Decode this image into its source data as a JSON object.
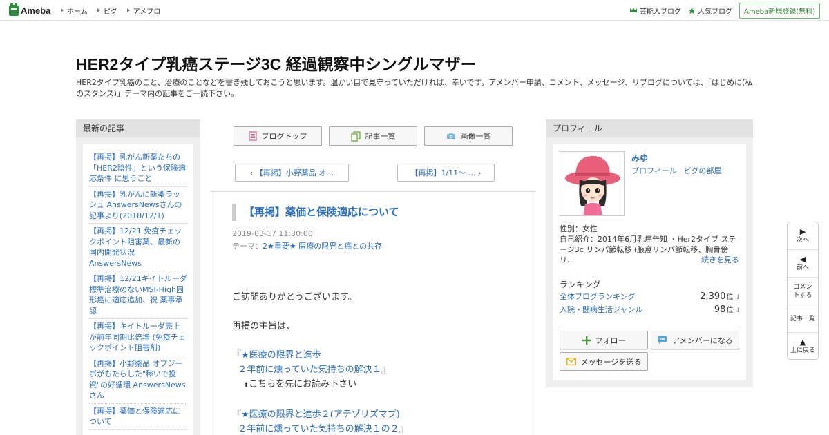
{
  "topbar": {
    "logo_text": "Ameba",
    "nav": [
      "ホーム",
      "ピグ",
      "アメブロ"
    ],
    "right_links": [
      "芸能人ブログ",
      "人気ブログ"
    ],
    "signup": "Ameba新規登録(無料)"
  },
  "header": {
    "title": "HER2タイプ乳癌ステージ3C 経過観察中シングルマザー",
    "description": "HER2タイプ乳癌のこと、治療のことなどを書き残しておこうと思います。温かい目で見守っていただければ、幸いです。アメンバー申請、コメント、メッセージ、リブログについては、「はじめに(私のスタンス)」テーマ内の記事をご一読下さい。"
  },
  "left": {
    "heading": "最新の記事",
    "items": [
      "【再掲】乳がん新薬たちの「HER2陰性」という保険適応条件 に思うこと",
      "【再掲】乳がんに新薬ラッシュ AnswersNewsさんの記事より(2018/12/1)",
      "【再掲】12/21 免疫チェックポイント阻害薬、最新の国内開発状況 AnswersNews",
      "【再掲】12/21キイトルーダ標準治療のないMSI-High固形癌に適応追加、祝 薬事承認",
      "【再掲】キイトルーダ売上が前年同期比倍増 (免疫チェックポイント阻害剤)",
      "【再掲】小野薬品 オプジーボがもたらした\"稼いで投資\"の好循環 AnswersNewsさん",
      "【再掲】薬価と保険適応について"
    ]
  },
  "center": {
    "nav_buttons": [
      "ブログトップ",
      "記事一覧",
      "画像一覧"
    ],
    "prev_label": "【再掲】小野薬品 オ…",
    "next_label": "【再掲】1/11～ …",
    "article": {
      "title": "【再掲】薬価と保険適応について",
      "date": "2019-03-17 11:30:00",
      "theme_prefix": "テーマ：",
      "theme": "2★重要★ 医療の限界と癌との共存",
      "p1": "ご訪問ありがとうございます。",
      "p2": "再掲の主旨は、",
      "link1_line1": "★医療の限界と進歩",
      "link1_line2": "２年前に燻っていた気持ちの解決１",
      "note": "こちらを先にお読み下さい",
      "link2_line1": "★医療の限界と進歩２(アテゾリズマブ)",
      "link2_line2": "２年前に燻っていた気持ちの解決１の２",
      "open_bracket": "『",
      "close_bracket": "』",
      "arrow": "⬆"
    }
  },
  "right": {
    "heading": "プロフィール",
    "name": "みゆ",
    "link_profile": "プロフィール",
    "link_sep": "|",
    "link_pig": "ピグの部屋",
    "gender": "性別：女性",
    "intro": "自己紹介：2014年6月乳癌告知 ・Her2タイプ ステージ3c リンパ節転移 (腋窩リンパ節転移、胸骨傍リ...",
    "more": "続きを見る",
    "ranking_heading": "ランキング",
    "rank1_label": "全体ブログランキング",
    "rank1_value": "2,390",
    "rank2_label": "入院・闘病生活ジャンル",
    "rank2_value": "98",
    "rank_unit": "位",
    "rank_arrow": "↓",
    "follow": "フォロー",
    "amember": "アメンバーになる",
    "message": "メッセージを送る"
  },
  "side_nav": [
    {
      "glyph": "▶",
      "label": "次へ"
    },
    {
      "glyph": "◀",
      "label": "前へ"
    },
    {
      "glyph": "",
      "label": "コメントする"
    },
    {
      "glyph": "",
      "label": "記事一覧"
    },
    {
      "glyph": "▲",
      "label": "上に戻る"
    }
  ],
  "colors": {
    "link": "#2a6ebb",
    "brand": "#2d8c3c"
  }
}
